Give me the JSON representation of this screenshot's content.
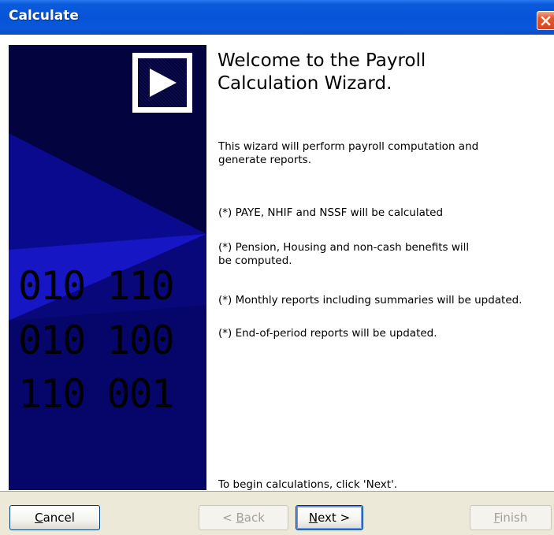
{
  "window": {
    "title": "Calculate",
    "close_icon": "close-icon"
  },
  "banner": {
    "logo_icon": "play-arrow-icon",
    "binary_lines": [
      "010 110",
      "010 100",
      "110 001"
    ]
  },
  "content": {
    "heading_line1": "Welcome to the Payroll",
    "heading_line2": "Calculation Wizard.",
    "intro_line1": "This wizard will perform payroll computation and",
    "intro_line2": "generate reports.",
    "bullet1": "(*) PAYE, NHIF and NSSF will be calculated",
    "bullet2_line1": "(*) Pension, Housing and non-cash benefits will",
    "bullet2_line2": "be computed.",
    "bullet3": "(*) Monthly reports including summaries will be updated.",
    "bullet4": "(*) End-of-period reports will be updated.",
    "footer_hint": "To begin calculations, click 'Next'."
  },
  "buttons": {
    "cancel": {
      "mnemonic": "C",
      "rest": "ancel"
    },
    "back": {
      "prefix": "< ",
      "mnemonic": "B",
      "rest": "ack"
    },
    "next": {
      "mnemonic": "N",
      "rest": "ext >"
    },
    "finish": {
      "mnemonic": "F",
      "rest": "inish"
    }
  },
  "colors": {
    "titlebar": "#0753d8",
    "banner_dark": "#030340",
    "banner_mid": "#0a0a8e",
    "banner_light": "#1414c2",
    "dialog_face": "#ece9d8"
  }
}
